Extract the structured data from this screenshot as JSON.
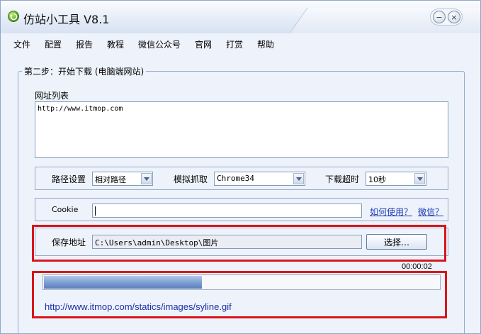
{
  "window": {
    "title": "仿站小工具 V8.1",
    "min_glyph": "−",
    "close_glyph": "×"
  },
  "menu": [
    "文件",
    "配置",
    "报告",
    "教程",
    "微信公众号",
    "官网",
    "打赏",
    "帮助"
  ],
  "step": {
    "legend": "第二步：开始下载 (电脑端网站)",
    "url_list_label": "网址列表",
    "url_list_value": "http://www.itmop.com"
  },
  "settings": {
    "path_label": "路径设置",
    "path_value": "相对路径",
    "ua_label": "模拟抓取",
    "ua_value": "Chrome34",
    "timeout_label": "下载超时",
    "timeout_value": "10秒"
  },
  "cookie": {
    "label": "Cookie",
    "value": "",
    "how_to_link": "如何使用？",
    "wechat_link": "微信？"
  },
  "save": {
    "label": "保存地址",
    "value": "C:\\Users\\admin\\Desktop\\图片",
    "choose_button": "选择…"
  },
  "progress": {
    "elapsed": "00:00:02",
    "fraction": 0.4,
    "current_url": "http://www.itmop.com/statics/images/syline.gif"
  },
  "colors": {
    "highlight_border": "#d8161a",
    "link": "#1a3ab5"
  },
  "icons": {
    "app": "app-icon",
    "minimize": "minimize-icon",
    "close": "close-icon",
    "dropdown": "chevron-down-icon"
  }
}
